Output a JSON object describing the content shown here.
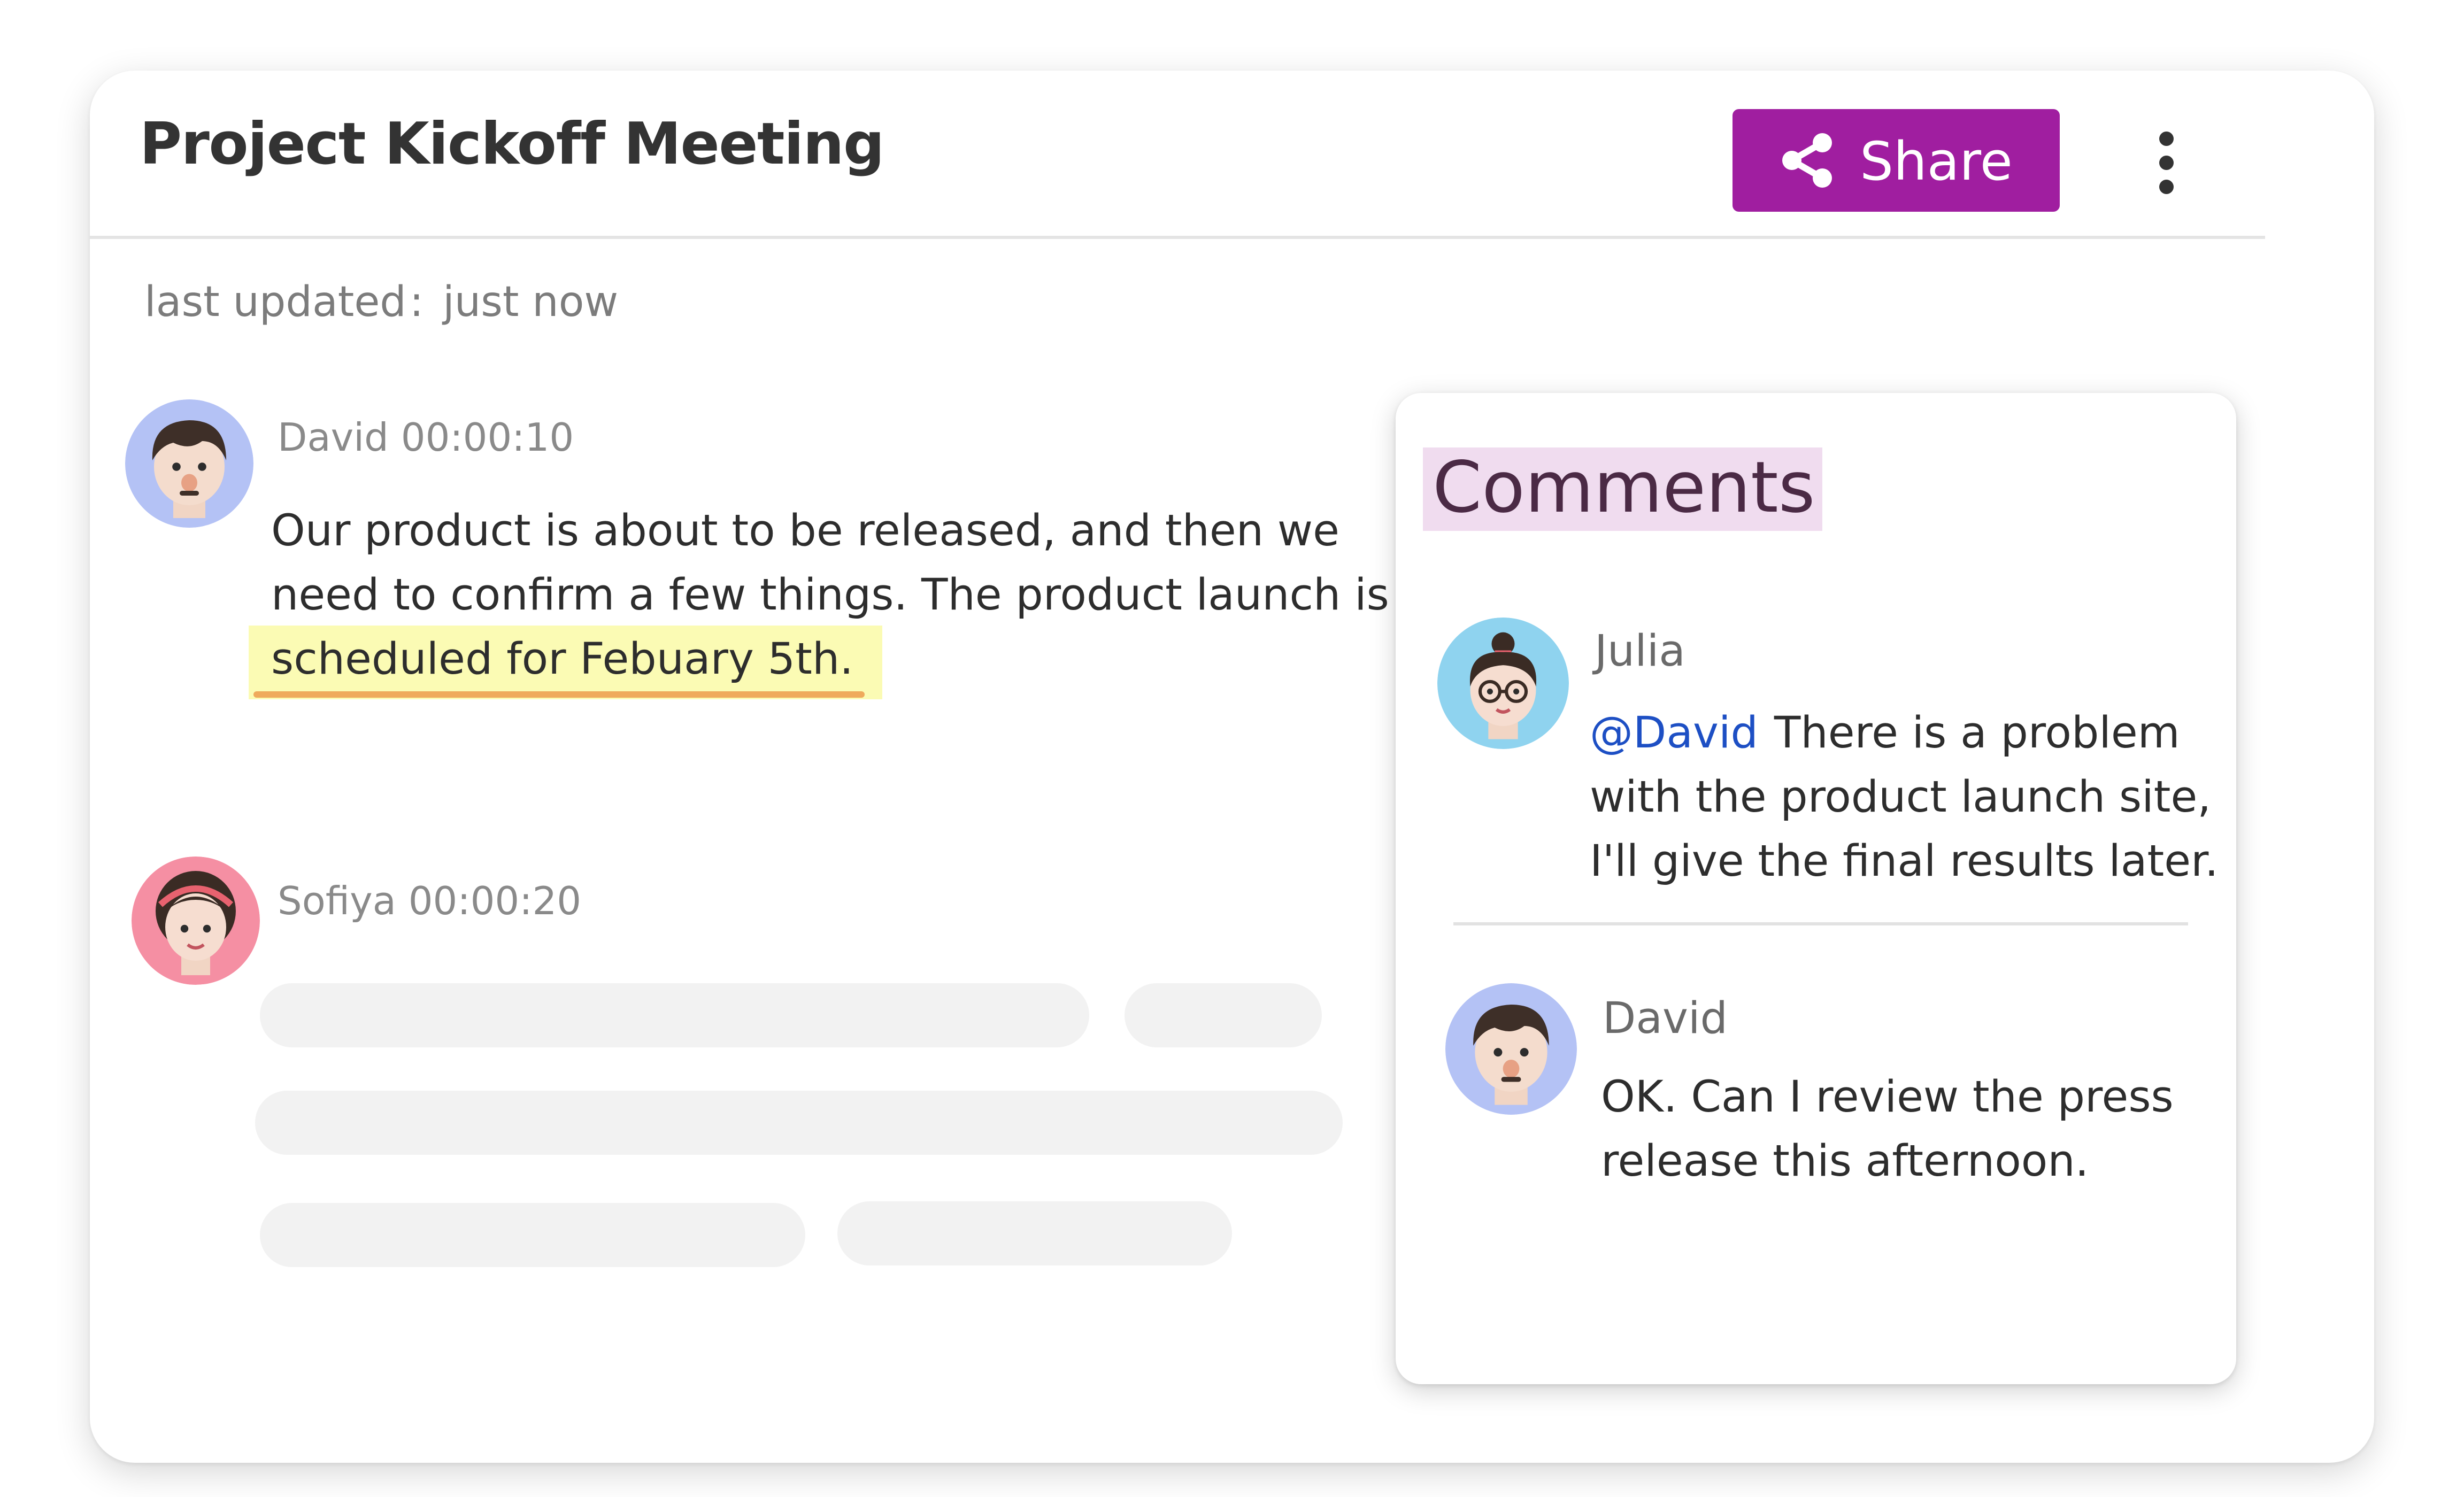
{
  "document": {
    "title": "Project Kickoff Meeting",
    "share_label": "Share",
    "more_icon": "more-vertical-icon",
    "share_icon": "share-icon",
    "last_updated_label": "last updated",
    "last_updated_separator": ":",
    "last_updated_value": "just now"
  },
  "transcript": [
    {
      "speaker": "David",
      "time": "00:00:10",
      "meta": "David 00:00:10",
      "text_before": "Our product is about to be released, and then we need to confirm a few things. The product launch is",
      "text_highlight": "scheduled for Febuary 5th.",
      "avatar": "david-avatar"
    },
    {
      "speaker": "Sofiya",
      "time": "00:00:20",
      "meta": "Sofiya 00:00:20",
      "avatar": "sofiya-avatar"
    }
  ],
  "comments": {
    "title": "Comments",
    "items": [
      {
        "name": "Julia",
        "mention": "@David",
        "text": "There is a problem with the product launch site, I'll give the final results later.",
        "avatar": "julia-avatar"
      },
      {
        "name": "David",
        "text": "OK. Can I review the press release this afternoon.",
        "avatar": "david-avatar"
      }
    ]
  },
  "colors": {
    "accent": "#a01ea0",
    "highlight": "#fbfbb4",
    "underline": "#efaa5c",
    "comments_title_bg": "#f0dcef",
    "mention": "#1d4fc4",
    "david_avatar_bg": "#b4c2f5",
    "sofiya_avatar_bg": "#f58fa3",
    "julia_avatar_bg": "#8fd3ef"
  }
}
